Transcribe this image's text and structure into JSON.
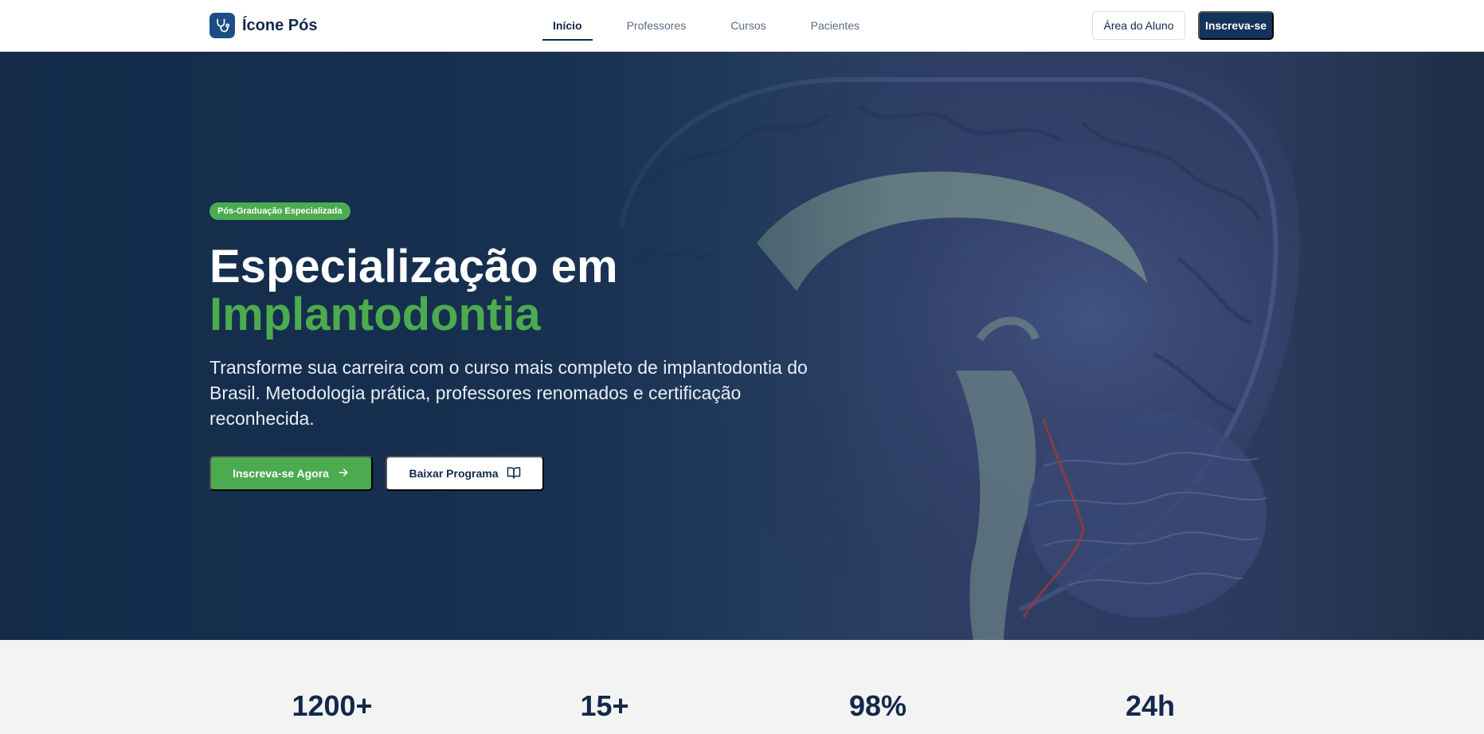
{
  "header": {
    "logo_text": "Ícone Pós",
    "logo_icon": "stethoscope-icon",
    "nav": [
      {
        "label": "Início",
        "active": true
      },
      {
        "label": "Professores",
        "active": false
      },
      {
        "label": "Cursos",
        "active": false
      },
      {
        "label": "Pacientes",
        "active": false
      }
    ],
    "student_area_label": "Área do Aluno",
    "signup_label": "Inscreva-se"
  },
  "hero": {
    "badge": "Pós-Graduação Especializada",
    "title_line1": "Especialização em",
    "title_line2": "Implantodontia",
    "subtitle": "Transforme sua carreira com o curso mais completo de implantodontia do Brasil. Metodologia prática, professores renomados e certificação reconhecida.",
    "cta_primary": "Inscreva-se Agora",
    "cta_primary_icon": "arrow-right-icon",
    "cta_secondary": "Baixar Programa",
    "cta_secondary_icon": "book-open-icon",
    "background_image": "brain-model-photo"
  },
  "stats": [
    {
      "value": "1200+"
    },
    {
      "value": "15+"
    },
    {
      "value": "98%"
    },
    {
      "value": "24h"
    }
  ],
  "colors": {
    "brand_navy": "#14335a",
    "accent_green": "#4cab4f",
    "hero_overlay": "#16304f"
  }
}
